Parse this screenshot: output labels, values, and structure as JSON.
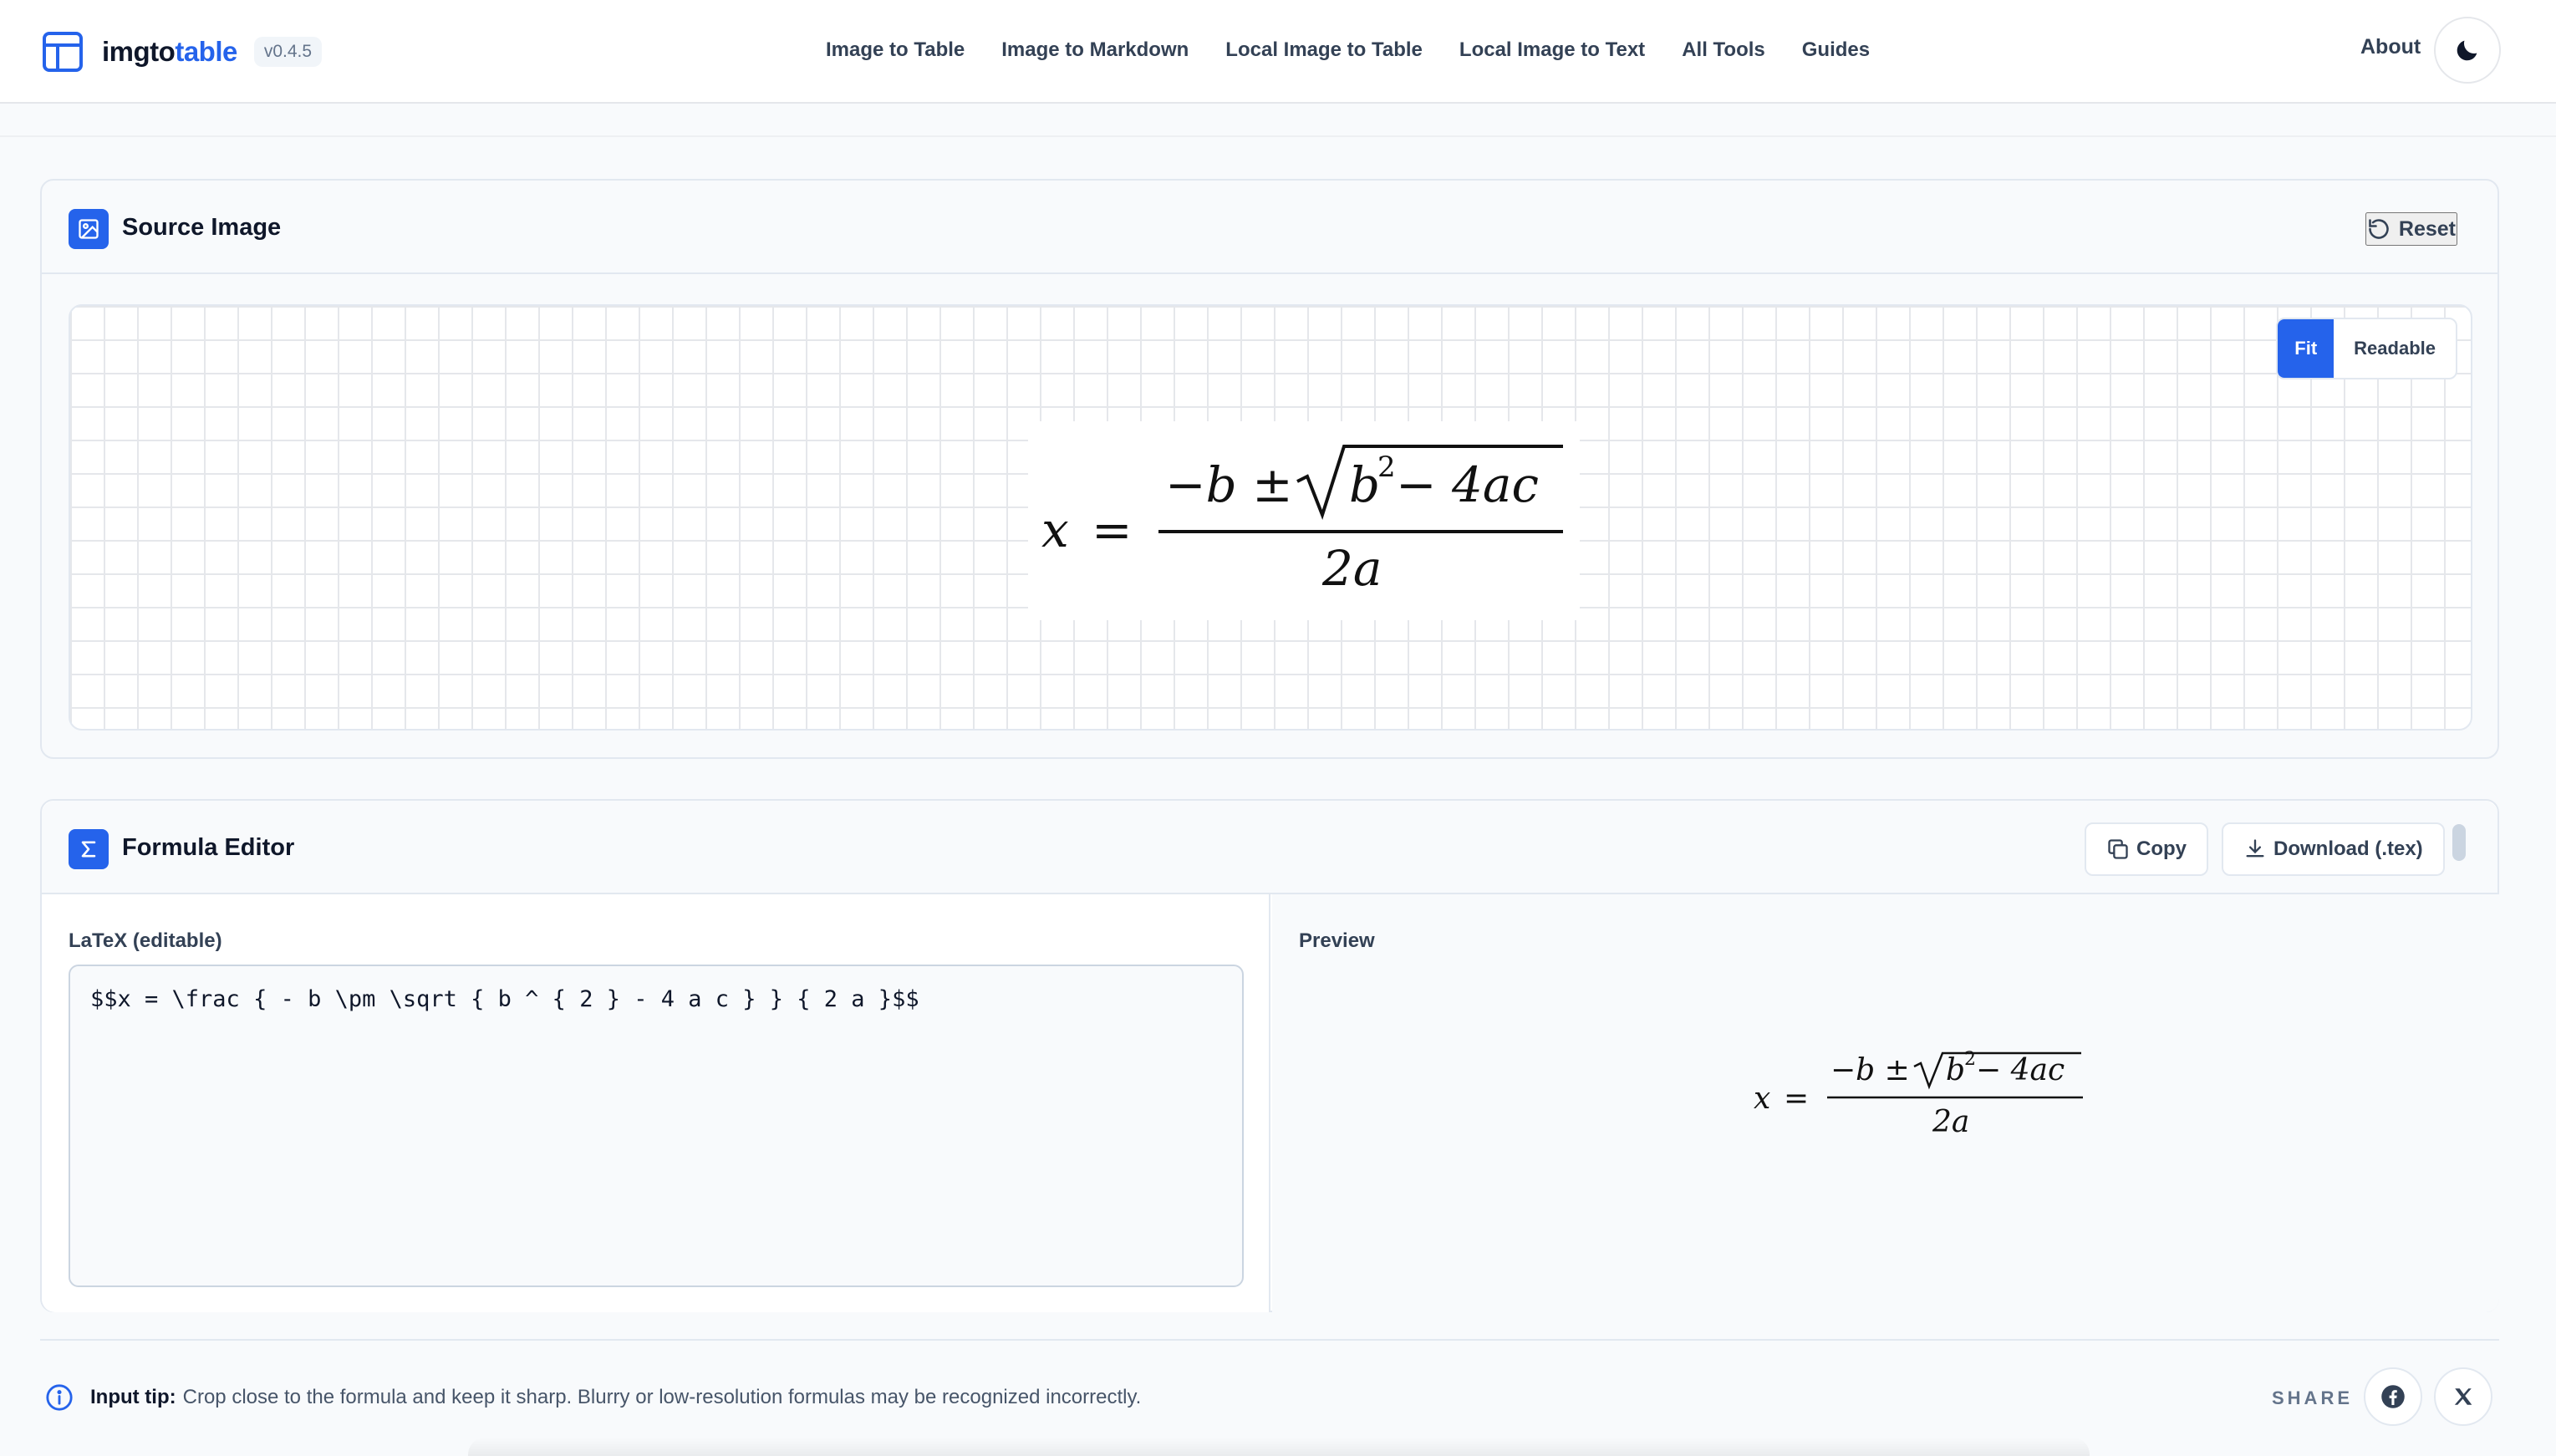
{
  "brand": {
    "name_prefix": "imgto",
    "name_accent": "table",
    "version": "v0.4.5"
  },
  "nav": {
    "links": [
      "Image to Table",
      "Image to Markdown",
      "Local Image to Table",
      "Local Image to Text",
      "All Tools",
      "Guides"
    ],
    "about": "About"
  },
  "source": {
    "title": "Source Image",
    "reset_label": "Reset",
    "zoom_options": [
      "Fit",
      "Readable"
    ],
    "zoom_selected": "Fit"
  },
  "editor": {
    "title": "Formula Editor",
    "copy_label": "Copy",
    "download_label": "Download (.tex)",
    "latex_label": "LaTeX (editable)",
    "latex_value": "$$x = \\frac { - b \\pm \\sqrt { b ^ { 2 } - 4 a c } } { 2 a }$$",
    "preview_label": "Preview"
  },
  "formula": {
    "lhs": "x",
    "eq": "=",
    "numerator_pre": "−b ± ",
    "radicand_base": "b",
    "radicand_exp": "2",
    "radicand_rest": " − 4ac",
    "denominator": "2a"
  },
  "footer": {
    "tip_label": "Input tip:",
    "tip_text": "Crop close to the formula and keep it sharp. Blurry or low-resolution formulas may be recognized incorrectly.",
    "share_label": "SHARE"
  },
  "colors": {
    "accent": "#2563eb",
    "text": "#0f172a",
    "muted": "#64748b",
    "border": "#e2e8f0"
  }
}
